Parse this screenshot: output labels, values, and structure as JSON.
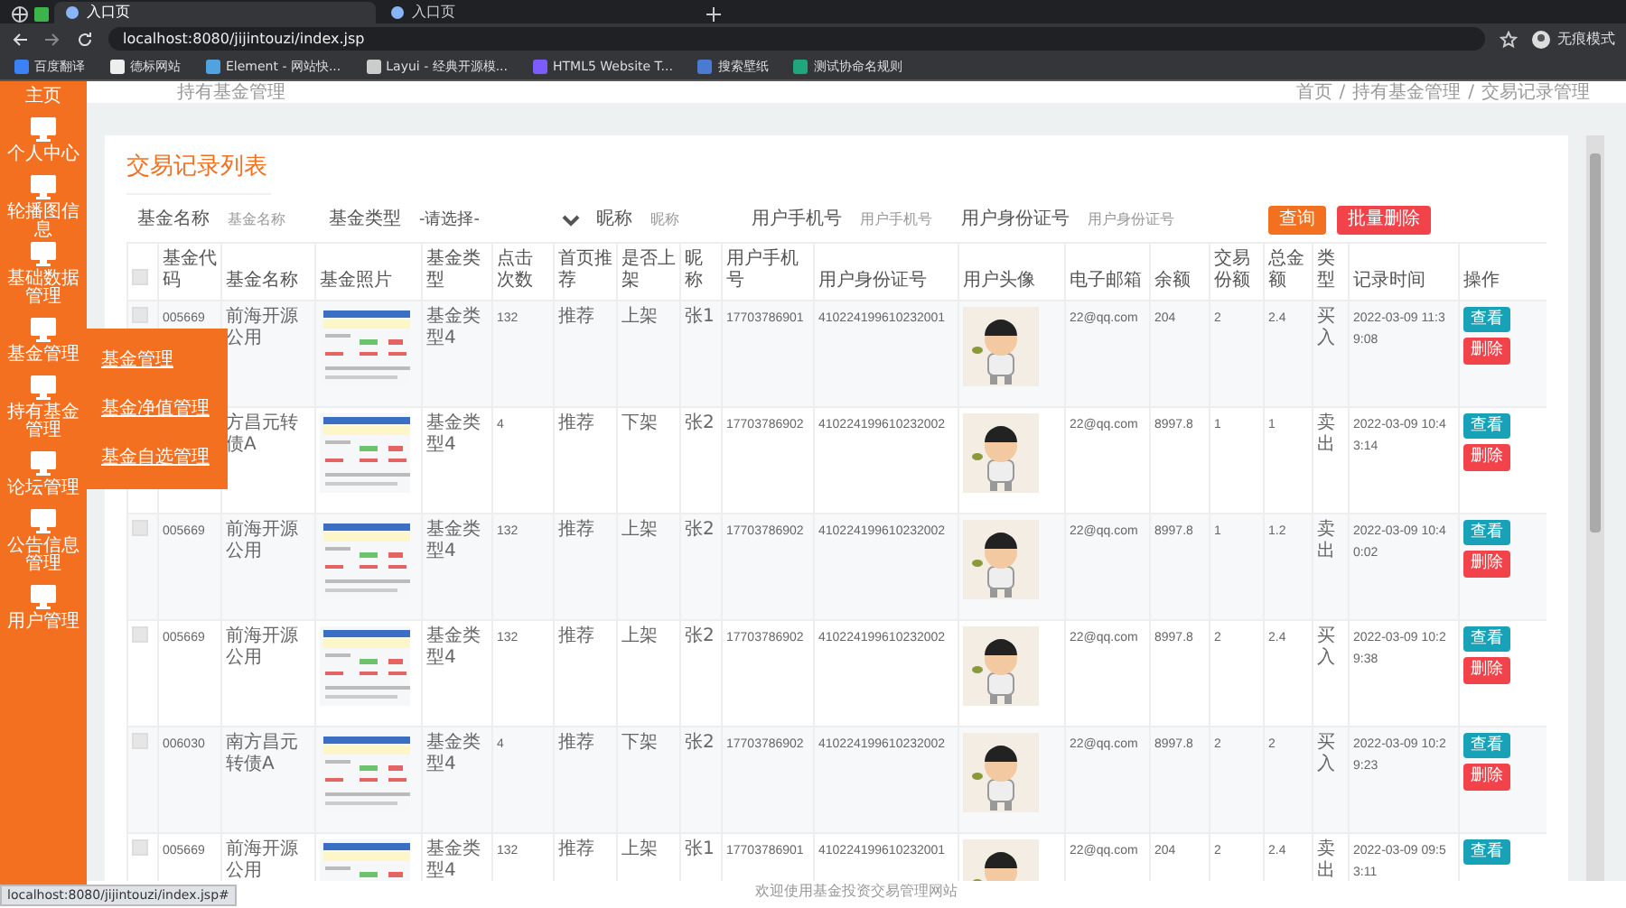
{
  "browser": {
    "tabs": [
      {
        "title": "入口页",
        "selected": true
      },
      {
        "title": "入口页",
        "selected": false
      }
    ],
    "address": "localhost:8080/jijintouzi/index.jsp",
    "profile": "无痕模式",
    "bookmarks": [
      "百度翻译",
      "德标网站",
      "Element - 网站快...",
      "Layui - 经典开源模...",
      "HTML5 Website T...",
      "搜索壁纸",
      "测试协命名规则"
    ],
    "status_url": "localhost:8080/jijintouzi/index.jsp#"
  },
  "header": {
    "title": "持有基金管理",
    "breadcrumb": [
      "首页",
      "持有基金管理",
      "交易记录管理"
    ],
    "separator": "/"
  },
  "sidebar": {
    "items": [
      {
        "label": "主页"
      },
      {
        "label": "个人中心"
      },
      {
        "label": "轮播图信息"
      },
      {
        "label": "基础数据管理"
      },
      {
        "label": "基金管理"
      },
      {
        "label": "持有基金管理"
      },
      {
        "label": "论坛管理"
      },
      {
        "label": "公告信息管理"
      },
      {
        "label": "用户管理"
      }
    ],
    "submenu": [
      "基金管理",
      "基金净值管理",
      "基金自选管理"
    ]
  },
  "card": {
    "title": "交易记录列表",
    "filters": [
      {
        "kind": "text",
        "label": "基金名称",
        "placeholder": "基金名称"
      },
      {
        "kind": "select",
        "label": "基金类型",
        "value": "-请选择-"
      },
      {
        "kind": "text",
        "label": "昵称",
        "placeholder": "昵称"
      },
      {
        "kind": "text",
        "label": "用户手机号",
        "placeholder": "用户手机号"
      },
      {
        "kind": "text",
        "label": "用户身份证号",
        "placeholder": "用户身份证号"
      }
    ],
    "buttons": [
      {
        "label": "查询",
        "kind": "search"
      },
      {
        "label": "批量删除",
        "kind": "delete"
      }
    ]
  },
  "table": {
    "header_checkbox": {
      "checked": false
    },
    "columns": [
      "基金代码",
      "基金名称",
      "基金照片",
      "基金类型",
      "点击次数",
      "首页推荐",
      "是否上架",
      "昵称",
      "用户手机号",
      "用户身份证号",
      "用户头像",
      "电子邮箱",
      "余额",
      "交易份额",
      "总金额",
      "类型",
      "记录时间",
      "操作"
    ],
    "rows": [
      {
        "checked": false,
        "code": "005669",
        "name": "前海开源公用",
        "photo": {
          "kind": "picture"
        },
        "fund_type": "基金类型4",
        "clicks": "132",
        "recommend": "推荐",
        "listed": "上架",
        "nickname": "张1",
        "phone": "17703786901",
        "id_number": "410224199610232001",
        "avatar": {
          "kind": "picture"
        },
        "email": "22@qq.com",
        "balance": "204",
        "shares": "2",
        "amount": "2.4",
        "trade_type": "买入",
        "time": "2022-03-09 11:39:08",
        "actions": [
          {
            "label": "查看",
            "kind": "view"
          },
          {
            "label": "删除",
            "kind": "delete"
          }
        ]
      },
      {
        "name": "方昌元转债A",
        "photo": {
          "kind": "picture"
        },
        "fund_type": "基金类型4",
        "clicks": "4",
        "recommend": "推荐",
        "listed": "下架",
        "nickname": "张2",
        "phone": "17703786902",
        "id_number": "410224199610232002",
        "avatar": {
          "kind": "picture"
        },
        "email": "22@qq.com",
        "balance": "8997.8",
        "shares": "1",
        "amount": "1",
        "trade_type": "卖出",
        "time": "2022-03-09 10:43:14",
        "actions": [
          {
            "label": "查看",
            "kind": "view"
          },
          {
            "label": "删除",
            "kind": "delete"
          }
        ]
      },
      {
        "checked": false,
        "code": "005669",
        "name": "前海开源公用",
        "photo": {
          "kind": "picture"
        },
        "fund_type": "基金类型4",
        "clicks": "132",
        "recommend": "推荐",
        "listed": "上架",
        "nickname": "张2",
        "phone": "17703786902",
        "id_number": "410224199610232002",
        "avatar": {
          "kind": "picture"
        },
        "email": "22@qq.com",
        "balance": "8997.8",
        "shares": "1",
        "amount": "1.2",
        "trade_type": "卖出",
        "time": "2022-03-09 10:40:02",
        "actions": [
          {
            "label": "查看",
            "kind": "view"
          },
          {
            "label": "删除",
            "kind": "delete"
          }
        ]
      },
      {
        "checked": false,
        "code": "005669",
        "name": "前海开源公用",
        "photo": {
          "kind": "picture"
        },
        "fund_type": "基金类型4",
        "clicks": "132",
        "recommend": "推荐",
        "listed": "上架",
        "nickname": "张2",
        "phone": "17703786902",
        "id_number": "410224199610232002",
        "avatar": {
          "kind": "picture"
        },
        "email": "22@qq.com",
        "balance": "8997.8",
        "shares": "2",
        "amount": "2.4",
        "trade_type": "买入",
        "time": "2022-03-09 10:29:38",
        "actions": [
          {
            "label": "查看",
            "kind": "view"
          },
          {
            "label": "删除",
            "kind": "delete"
          }
        ]
      },
      {
        "checked": false,
        "code": "006030",
        "name": "南方昌元转债A",
        "photo": {
          "kind": "picture"
        },
        "fund_type": "基金类型4",
        "clicks": "4",
        "recommend": "推荐",
        "listed": "下架",
        "nickname": "张2",
        "phone": "17703786902",
        "id_number": "410224199610232002",
        "avatar": {
          "kind": "picture"
        },
        "email": "22@qq.com",
        "balance": "8997.8",
        "shares": "2",
        "amount": "2",
        "trade_type": "买入",
        "time": "2022-03-09 10:29:23",
        "actions": [
          {
            "label": "查看",
            "kind": "view"
          },
          {
            "label": "删除",
            "kind": "delete"
          }
        ]
      },
      {
        "checked": false,
        "code": "005669",
        "name": "前海开源公用",
        "photo": {
          "kind": "picture"
        },
        "fund_type": "基金类型4",
        "clicks": "132",
        "recommend": "推荐",
        "listed": "上架",
        "nickname": "张1",
        "phone": "17703786901",
        "id_number": "410224199610232001",
        "avatar": {
          "kind": "picture"
        },
        "email": "22@qq.com",
        "balance": "204",
        "shares": "2",
        "amount": "2.4",
        "trade_type": "卖出",
        "time": "2022-03-09 09:53:11",
        "actions": [
          {
            "label": "查看",
            "kind": "view"
          }
        ]
      }
    ]
  },
  "footer": "欢迎使用基金投资交易管理网站"
}
